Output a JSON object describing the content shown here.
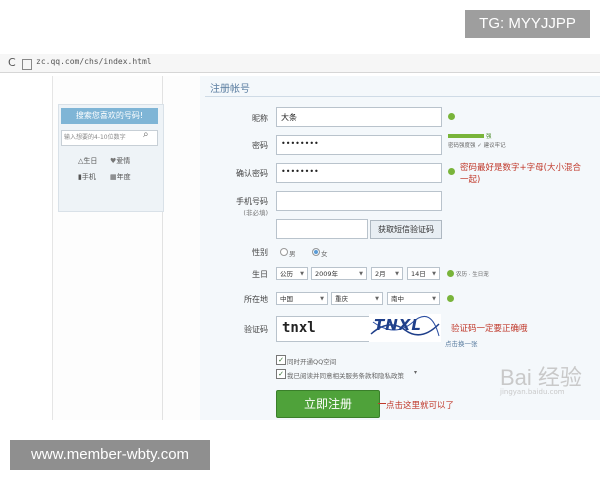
{
  "overlay": {
    "tg_label": "TG: MYYJJPP",
    "footer_label": "www.member-wbty.com"
  },
  "browser": {
    "url": "zc.qq.com/chs/index.html",
    "refresh_icon": "refresh-icon"
  },
  "sidebar": {
    "title": "搜索您喜欢的号码!",
    "search_placeholder": "输入想要的4-10位数字",
    "filters": [
      {
        "icon": "△",
        "label": "生日"
      },
      {
        "icon": "♥",
        "label": "爱情"
      },
      {
        "icon": "▮",
        "label": "手机"
      },
      {
        "icon": "▦",
        "label": "年度"
      }
    ]
  },
  "form": {
    "section_title": "注册帐号",
    "nickname": {
      "label": "昵称",
      "value": "大条"
    },
    "password": {
      "label": "密码",
      "value": "••••••••",
      "strength_hint": "强",
      "strength_sub": "密码强度强 ✓ 建议牢记"
    },
    "confirm": {
      "label": "确认密码",
      "value": "••••••••"
    },
    "password_tip": "密码最好是数字+字母(大小混合一起)",
    "phone": {
      "label": "手机号码",
      "sublabel": "(非必填)",
      "value": ""
    },
    "sms_button": "获取短信验证码",
    "gender": {
      "label": "性别",
      "options": [
        "男",
        "女"
      ],
      "selected": "女"
    },
    "birthday": {
      "label": "生日",
      "calendar": "公历",
      "year": "2009年",
      "month": "2月",
      "day": "14日",
      "tip": "农历 · 生日宠"
    },
    "location": {
      "label": "所在地",
      "country": "中国",
      "province": "重庆",
      "city": "南中"
    },
    "captcha": {
      "label": "验证码",
      "value": "tnxl",
      "image_text": "TNXL",
      "tip": "验证码一定要正确哦",
      "refresh": "点击换一张"
    },
    "checkbox_qzone": "同时开通QQ空间",
    "checkbox_agree": "我已阅读并同意相关服务条款和隐私政策",
    "register_button": "立即注册",
    "register_tip": "点击这里就可以了"
  },
  "watermark": {
    "text": "Bai 经验",
    "sub": "jingyan.baidu.com"
  },
  "colors": {
    "accent_green": "#4fa23a",
    "tip_red": "#c0392b",
    "side_blue": "#7fb5d6"
  }
}
